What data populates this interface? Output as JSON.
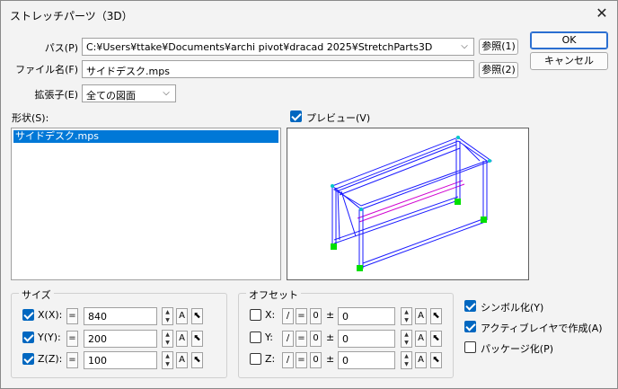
{
  "window": {
    "title": "ストレッチパーツ（3D）"
  },
  "fields": {
    "path_label": "パス(P)",
    "path_value": "C:¥Users¥ttake¥Documents¥archi pivot¥dracad 2025¥StretchParts3D",
    "browse1_label": "参照(1)",
    "filename_label": "ファイル名(F)",
    "filename_value": "サイドデスク.mps",
    "browse2_label": "参照(2)",
    "ext_label": "拡張子(E)",
    "ext_value": "全ての図面"
  },
  "buttons": {
    "ok": "OK",
    "cancel": "キャンセル"
  },
  "shape": {
    "label": "形状(S):",
    "items": [
      "サイドデスク.mps"
    ]
  },
  "preview": {
    "label": "プレビュー(V)",
    "checked": true
  },
  "size_group": {
    "title": "サイズ",
    "rows": [
      {
        "label": "X(X):",
        "checked": true,
        "eq": "=",
        "value": "840",
        "a": "A"
      },
      {
        "label": "Y(Y):",
        "checked": true,
        "eq": "=",
        "value": "200",
        "a": "A"
      },
      {
        "label": "Z(Z):",
        "checked": true,
        "eq": "=",
        "value": "100",
        "a": "A"
      }
    ]
  },
  "offset_group": {
    "title": "オフセット",
    "rows": [
      {
        "label": "X:",
        "checked": false,
        "slash": "/",
        "eq": "=",
        "zero": "0",
        "pm": "±",
        "value": "0",
        "a": "A"
      },
      {
        "label": "Y:",
        "checked": false,
        "slash": "/",
        "eq": "=",
        "zero": "0",
        "pm": "±",
        "value": "0",
        "a": "A"
      },
      {
        "label": "Z:",
        "checked": false,
        "slash": "/",
        "eq": "=",
        "zero": "0",
        "pm": "±",
        "value": "0",
        "a": "A"
      }
    ]
  },
  "options": [
    {
      "label": "シンボル化(Y)",
      "checked": true
    },
    {
      "label": "アクティブレイヤで作成(A)",
      "checked": true
    },
    {
      "label": "パッケージ化(P)",
      "checked": false
    }
  ],
  "colors": {
    "accent": "#0067c0",
    "selection": "#0078d7",
    "frame_blue": "#1a1aff",
    "frame_magenta": "#d000d0",
    "frame_green": "#00e000"
  }
}
